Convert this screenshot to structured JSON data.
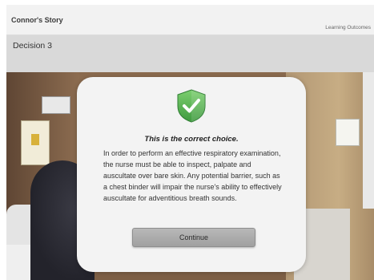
{
  "header": {
    "story_title": "Connor's Story",
    "outcomes_link": "Learning Outcomes"
  },
  "decision": {
    "title": "Decision 3"
  },
  "dialog": {
    "icon": "shield-check-icon",
    "heading": "This is the correct choice.",
    "body": "In order to perform an effective respiratory examination, the nurse must be able to inspect, palpate and auscultate over bare skin. Any potential barrier, such as a chest binder will impair the nurse's ability to effectively auscultate for adventitious breath sounds.",
    "continue_label": "Continue"
  },
  "colors": {
    "shield_green": "#5cb85c",
    "decision_bar": "#d9d9d9",
    "button_gray": "#a8a8a8"
  }
}
